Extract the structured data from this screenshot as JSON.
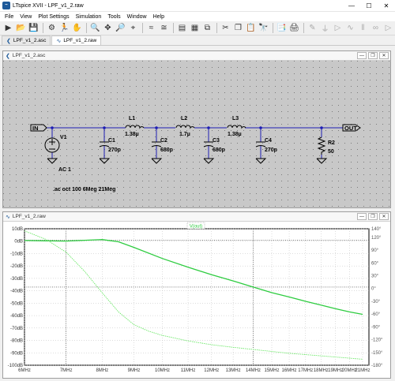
{
  "window": {
    "title": "LTspice XVII - LPF_v1_2.raw"
  },
  "menu": [
    "File",
    "View",
    "Plot Settings",
    "Simulation",
    "Tools",
    "Window",
    "Help"
  ],
  "tabs": [
    {
      "label": "LPF_v1_2.asc",
      "active": false
    },
    {
      "label": "LPF_v1_2.raw",
      "active": true
    }
  ],
  "schematic": {
    "title": "LPF_v1_2.asc",
    "port_in": "IN",
    "port_out": "OUT",
    "source": {
      "name": "V1",
      "value": "AC 1"
    },
    "components": [
      {
        "name": "C1",
        "value": "270p"
      },
      {
        "name": "L1",
        "value": "1.38µ"
      },
      {
        "name": "C2",
        "value": "680p"
      },
      {
        "name": "L2",
        "value": "1.7µ"
      },
      {
        "name": "C3",
        "value": "680p"
      },
      {
        "name": "L3",
        "value": "1.38µ"
      },
      {
        "name": "C4",
        "value": "270p"
      },
      {
        "name": "R2",
        "value": "50"
      }
    ],
    "directive": ".ac oct 100 6Meg 21Meg"
  },
  "plot": {
    "title": "LPF_v1_2.raw",
    "trace_label": "V(out)",
    "colors": {
      "trace": "#2ecc40",
      "phase": "#6ee86a",
      "grid": "#222222",
      "bg": "#ffffff"
    }
  },
  "chart_data": {
    "type": "line",
    "xlabel": "",
    "ylabel": "",
    "x_scale": "log",
    "xlim": [
      6,
      21.5
    ],
    "ylim": [
      -100,
      10
    ],
    "y2lim": [
      -180,
      140
    ],
    "x_ticks": [
      "6MHz",
      "7MHz",
      "8MHz",
      "9MHz",
      "10MHz",
      "11MHz",
      "12MHz",
      "13MHz",
      "14MHz",
      "15MHz",
      "16MHz",
      "17MHz",
      "18MHz",
      "19MHz",
      "20MHz",
      "21MHz"
    ],
    "y_ticks": [
      "10dB",
      "0dB",
      "-10dB",
      "-20dB",
      "-30dB",
      "-40dB",
      "-50dB",
      "-60dB",
      "-70dB",
      "-80dB",
      "-90dB",
      "-100dB"
    ],
    "y2_ticks": [
      "140°",
      "120°",
      "90°",
      "60°",
      "30°",
      "0°",
      "-30°",
      "-60°",
      "-90°",
      "-120°",
      "-150°",
      "-180°"
    ],
    "series": [
      {
        "name": "V(out)",
        "axis": "left",
        "x": [
          6,
          6.5,
          7,
          7.5,
          8,
          8.5,
          9,
          10,
          11,
          12,
          13,
          14,
          15,
          16,
          17,
          18,
          19,
          20,
          21
        ],
        "values": [
          0.5,
          0.3,
          0.1,
          0.7,
          1.3,
          -0.5,
          -5,
          -14,
          -21,
          -27,
          -32,
          -37,
          -41.5,
          -45,
          -48.5,
          -51.5,
          -54.5,
          -57,
          -59
        ]
      },
      {
        "name": "",
        "axis": "right",
        "x": [
          6,
          6.5,
          7,
          7.5,
          8,
          8.5,
          9,
          9.5,
          10,
          11,
          12,
          13,
          14,
          16,
          18,
          21
        ],
        "values": [
          135,
          115,
          85,
          40,
          -10,
          -55,
          -85,
          -100,
          -110,
          -123,
          -132,
          -138,
          -143,
          -152,
          -158,
          -166
        ]
      }
    ]
  }
}
